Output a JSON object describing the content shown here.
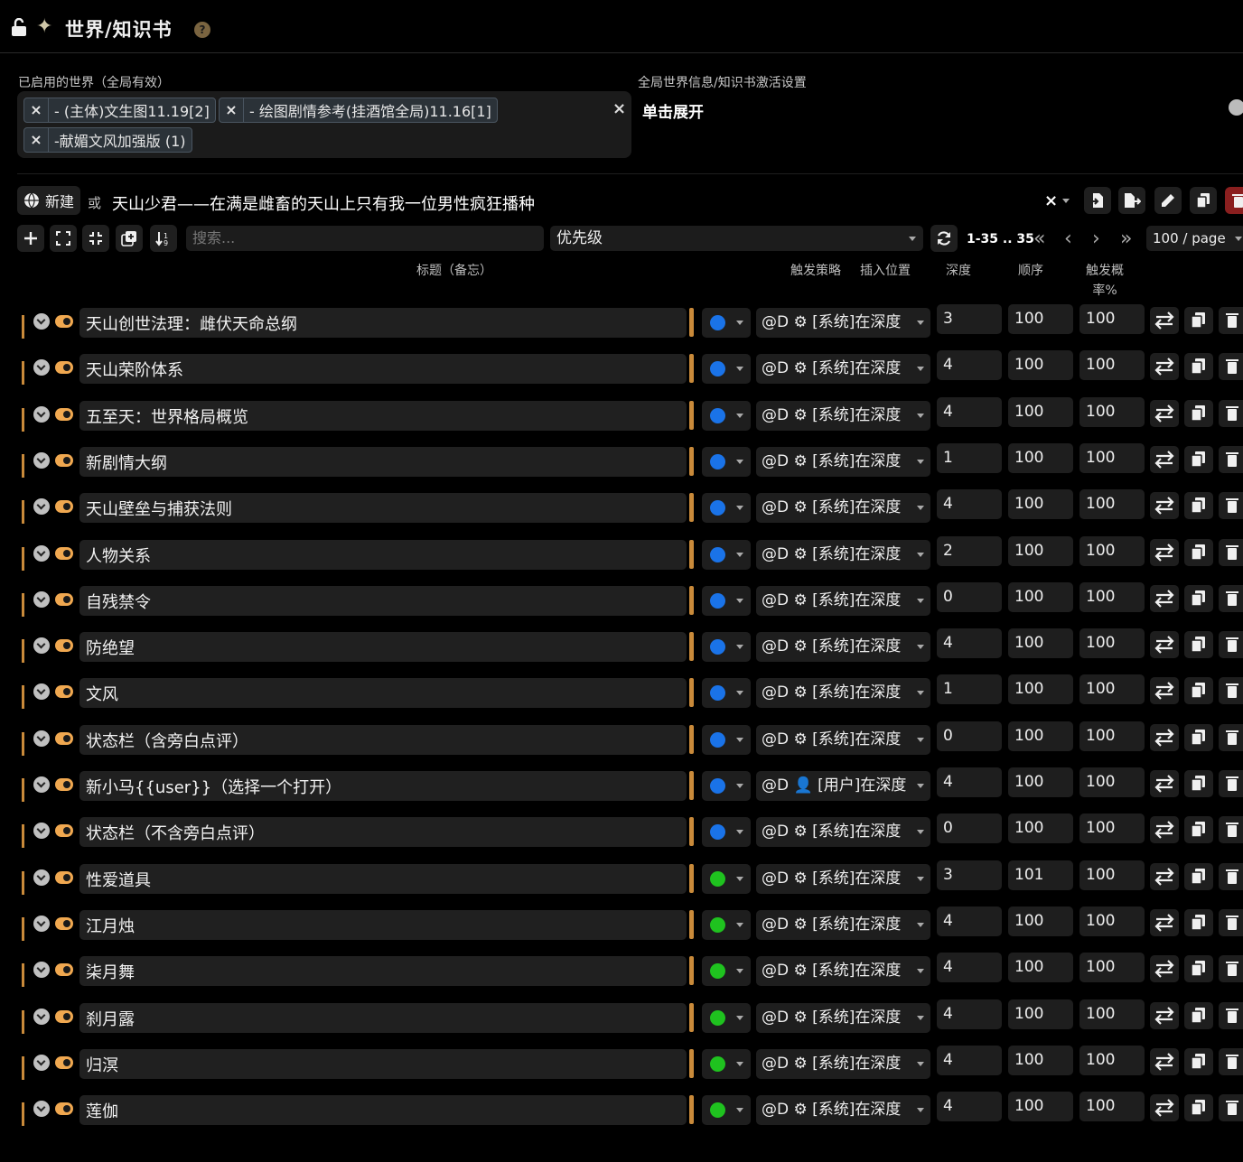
{
  "header": {
    "title": "世界/知识书",
    "help": "?"
  },
  "global": {
    "active_label": "已启用的世界（全局有效）",
    "chips": [
      "- (主体)文生图11.19[2]",
      "- 绘图剧情参考(挂酒馆全局)11.16[1]",
      "-献媚文风加强版 (1)"
    ],
    "chip_x": "×",
    "clear_x": "×",
    "settings_label": "全局世界信息/知识书激活设置",
    "expand": "单击展开"
  },
  "editor": {
    "new_label": "新建",
    "or_label": "或",
    "book_name": "天山少君——在满是雌畜的天山上只有我一位男性疯狂播种",
    "clear": "×"
  },
  "toolbar": {
    "search_placeholder": "搜索...",
    "sort": "优先级",
    "pagination": "1-35 .. 35",
    "per_page": "100 / page",
    "nav": [
      "«",
      "‹",
      "›",
      "»"
    ]
  },
  "columns": {
    "title": "标题（备忘）",
    "strategy": "触发策略",
    "position": "插入位置",
    "depth": "深度",
    "order": "顺序",
    "prob": "触发概率%"
  },
  "colors": {
    "blue": "#1a73e8",
    "green": "#1fc21f",
    "accent": "#c98a3a"
  },
  "entries": [
    {
      "title": "天山创世法理：雌伏天命总纲",
      "status": "blue",
      "pos": "@D ⚙ [系统]在深度",
      "depth": "3",
      "order": "100",
      "prob": "100"
    },
    {
      "title": "天山荣阶体系",
      "status": "blue",
      "pos": "@D ⚙ [系统]在深度",
      "depth": "4",
      "order": "100",
      "prob": "100"
    },
    {
      "title": "五至天：世界格局概览",
      "status": "blue",
      "pos": "@D ⚙ [系统]在深度",
      "depth": "4",
      "order": "100",
      "prob": "100"
    },
    {
      "title": "新剧情大纲",
      "status": "blue",
      "pos": "@D ⚙ [系统]在深度",
      "depth": "1",
      "order": "100",
      "prob": "100"
    },
    {
      "title": "天山壁垒与捕获法则",
      "status": "blue",
      "pos": "@D ⚙ [系统]在深度",
      "depth": "4",
      "order": "100",
      "prob": "100"
    },
    {
      "title": "人物关系",
      "status": "blue",
      "pos": "@D ⚙ [系统]在深度",
      "depth": "2",
      "order": "100",
      "prob": "100"
    },
    {
      "title": "自残禁令",
      "status": "blue",
      "pos": "@D ⚙ [系统]在深度",
      "depth": "0",
      "order": "100",
      "prob": "100"
    },
    {
      "title": "防绝望",
      "status": "blue",
      "pos": "@D ⚙ [系统]在深度",
      "depth": "4",
      "order": "100",
      "prob": "100"
    },
    {
      "title": "文风",
      "status": "blue",
      "pos": "@D ⚙ [系统]在深度",
      "depth": "1",
      "order": "100",
      "prob": "100"
    },
    {
      "title": "状态栏（含旁白点评）",
      "status": "blue",
      "pos": "@D ⚙ [系统]在深度",
      "depth": "0",
      "order": "100",
      "prob": "100"
    },
    {
      "title": "新小马{{user}}（选择一个打开）",
      "status": "blue",
      "pos": "@D 👤 [用户]在深度",
      "depth": "4",
      "order": "100",
      "prob": "100"
    },
    {
      "title": "状态栏（不含旁白点评）",
      "status": "blue",
      "pos": "@D ⚙ [系统]在深度",
      "depth": "0",
      "order": "100",
      "prob": "100"
    },
    {
      "title": "性爱道具",
      "status": "green",
      "pos": "@D ⚙ [系统]在深度",
      "depth": "3",
      "order": "101",
      "prob": "100"
    },
    {
      "title": "江月烛",
      "status": "green",
      "pos": "@D ⚙ [系统]在深度",
      "depth": "4",
      "order": "100",
      "prob": "100"
    },
    {
      "title": "柒月舞",
      "status": "green",
      "pos": "@D ⚙ [系统]在深度",
      "depth": "4",
      "order": "100",
      "prob": "100"
    },
    {
      "title": "刹月露",
      "status": "green",
      "pos": "@D ⚙ [系统]在深度",
      "depth": "4",
      "order": "100",
      "prob": "100"
    },
    {
      "title": "归溟",
      "status": "green",
      "pos": "@D ⚙ [系统]在深度",
      "depth": "4",
      "order": "100",
      "prob": "100"
    },
    {
      "title": "莲伽",
      "status": "green",
      "pos": "@D ⚙ [系统]在深度",
      "depth": "4",
      "order": "100",
      "prob": "100"
    }
  ]
}
